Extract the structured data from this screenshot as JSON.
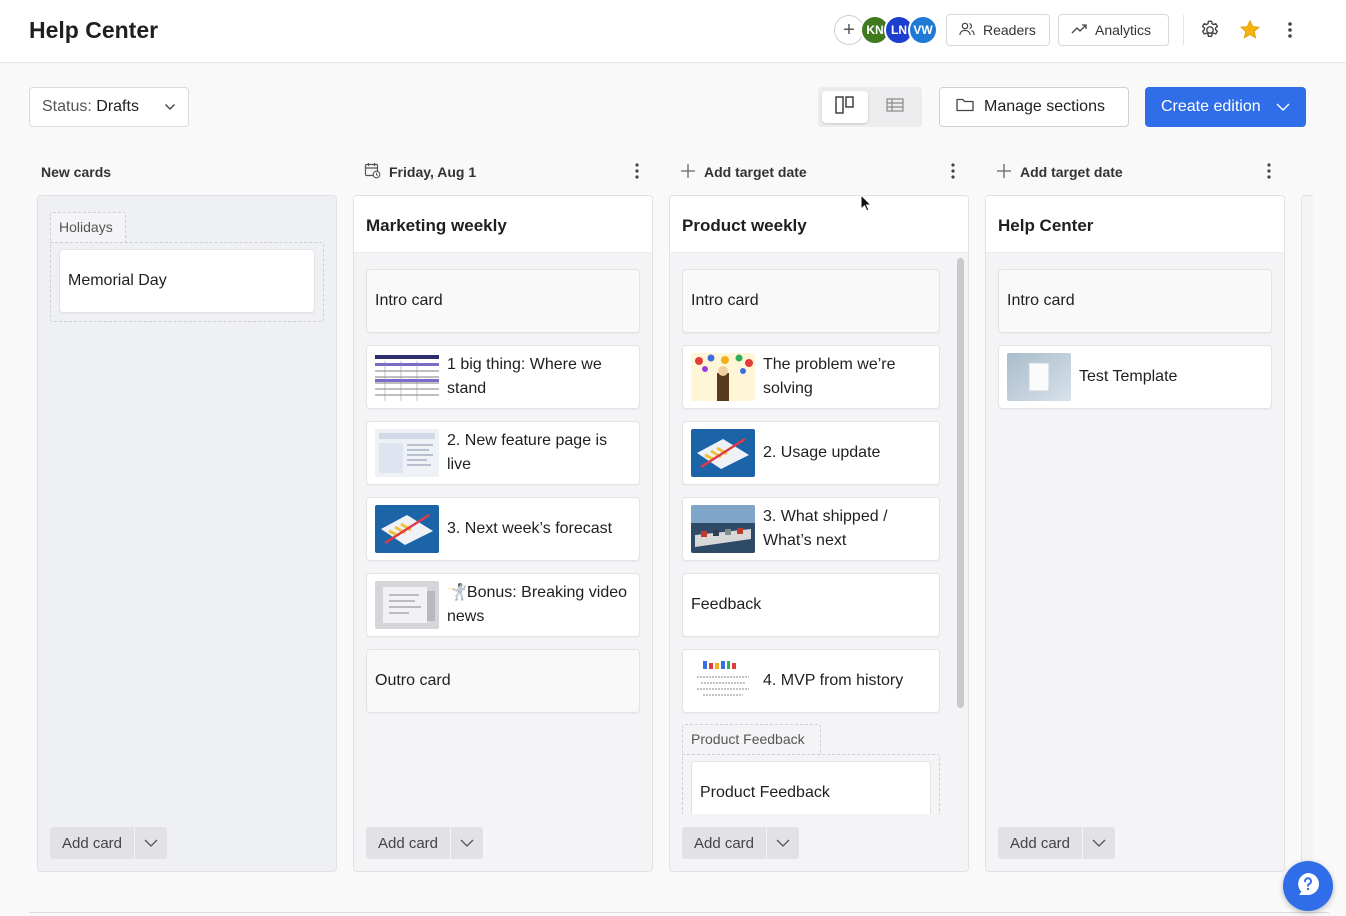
{
  "header": {
    "title": "Help Center",
    "avatars": [
      {
        "initials": "KN",
        "color": "#3f7a1f"
      },
      {
        "initials": "LN",
        "color": "#1d3fcf"
      },
      {
        "initials": "VW",
        "color": "#1f7ad6"
      }
    ],
    "add_member_glyph": "+",
    "readers_label": "Readers",
    "analytics_label": "Analytics",
    "settings_icon": "gear-icon",
    "star_icon": "star-icon",
    "star_color": "#f5b40b",
    "more_icon": "more-vertical-icon"
  },
  "toolbar": {
    "status_prefix": "Status:",
    "status_value": "Drafts",
    "manage_sections_label": "Manage sections",
    "create_edition_label": "Create edition",
    "accent": "#2f6ee8"
  },
  "columns": [
    {
      "header": "New cards",
      "groups": [
        {
          "tag": "Holidays",
          "cards": [
            {
              "text": "Memorial Day"
            }
          ]
        }
      ],
      "add_card_label": "Add card"
    },
    {
      "header": "Friday, Aug 1",
      "title": "Marketing weekly",
      "cards": [
        {
          "text": "Intro card"
        },
        {
          "text": "1 big thing: Where we stand"
        },
        {
          "text": "2. New feature page is live"
        },
        {
          "text": "3. Next week’s forecast"
        },
        {
          "text": "Bonus: Breaking video news"
        },
        {
          "text": "Outro card"
        }
      ],
      "add_card_label": "Add card"
    },
    {
      "header": "Add target date",
      "title": "Product weekly",
      "cards": [
        {
          "text": "Intro card"
        },
        {
          "text": "The problem we’re solving"
        },
        {
          "text": "2. Usage update"
        },
        {
          "text": "3. What shipped / What’s next"
        },
        {
          "text": "Feedback"
        },
        {
          "text": "4. MVP from history"
        }
      ],
      "groups": [
        {
          "tag": "Product Feedback",
          "cards": [
            {
              "text": "Product Feedback"
            }
          ]
        }
      ],
      "add_card_label": "Add card"
    },
    {
      "header": "Add target date",
      "title": "Help Center",
      "cards": [
        {
          "text": "Intro card"
        },
        {
          "text": "Test Template"
        }
      ],
      "add_card_label": "Add card"
    }
  ]
}
